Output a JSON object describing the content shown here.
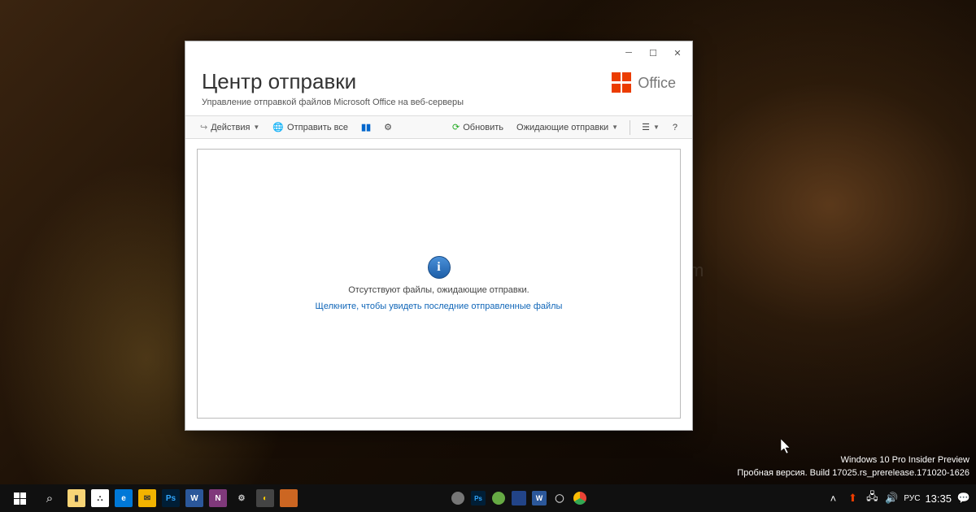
{
  "window": {
    "title": "Центр отправки",
    "subtitle": "Управление отправкой файлов Microsoft Office на веб-серверы",
    "brand_text": "Office"
  },
  "toolbar": {
    "actions": "Действия",
    "send_all": "Отправить все",
    "refresh": "Обновить",
    "pending_filter": "Ожидающие отправки"
  },
  "content": {
    "empty_message": "Отсутствуют файлы, ожидающие отправки.",
    "link_message": "Щелкните, чтобы увидеть последние отправленные файлы"
  },
  "insider": {
    "line1": "Windows 10 Pro Insider Preview",
    "line2": "Пробная версия. Build 17025.rs_prerelease.171020-1626"
  },
  "tray": {
    "lang": "РУС",
    "time": "13:35"
  },
  "watermark_text": "G-ek.com",
  "colors": {
    "office_orange": "#eb3c00",
    "link_blue": "#1066b8"
  }
}
